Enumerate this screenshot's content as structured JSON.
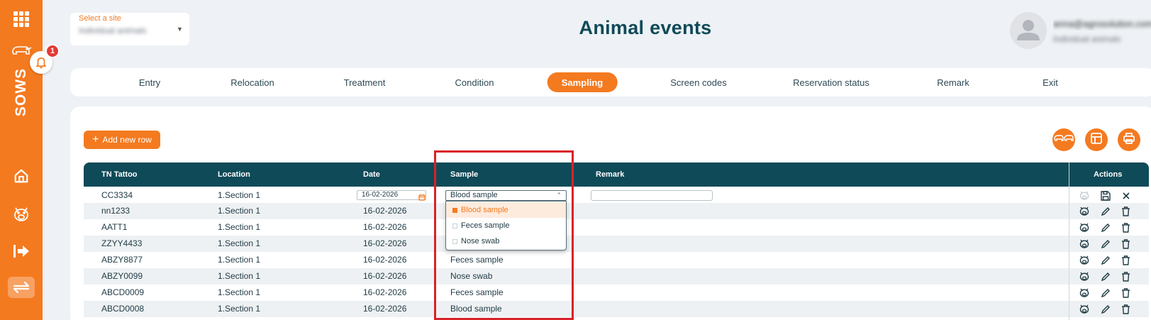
{
  "sidebar": {
    "app_label": "SOWS",
    "notification_count": "1",
    "icons": [
      "apps-grid-icon",
      "barn-icon",
      "bell-icon",
      "home-icon",
      "pig-icon",
      "exit-icon",
      "switch-icon"
    ]
  },
  "header": {
    "site_label": "Select a site",
    "site_value": "Individual animals",
    "title": "Animal events",
    "user_email": "anna@agrosolution.com",
    "user_site": "Individual animals"
  },
  "tabs": [
    {
      "label": "Entry",
      "active": false
    },
    {
      "label": "Relocation",
      "active": false
    },
    {
      "label": "Treatment",
      "active": false
    },
    {
      "label": "Condition",
      "active": false
    },
    {
      "label": "Sampling",
      "active": true
    },
    {
      "label": "Screen codes",
      "active": false
    },
    {
      "label": "Reservation status",
      "active": false
    },
    {
      "label": "Remark",
      "active": false
    },
    {
      "label": "Exit",
      "active": false
    }
  ],
  "toolbar": {
    "add_label": "Add new row",
    "icon_buttons": [
      "pigs-icon",
      "columns-icon",
      "print-icon"
    ]
  },
  "table": {
    "headers": {
      "tattoo": "TN Tattoo",
      "location": "Location",
      "date": "Date",
      "sample": "Sample",
      "remark": "Remark",
      "actions": "Actions"
    },
    "edit_row": {
      "tattoo": "CC3334",
      "location": "1.Section 1",
      "date": "16-02-2026",
      "sample": "Blood sample",
      "remark": ""
    },
    "rows": [
      {
        "tattoo": "nn1233",
        "location": "1.Section 1",
        "date": "16-02-2026",
        "sample": ""
      },
      {
        "tattoo": "AATT1",
        "location": "1.Section 1",
        "date": "16-02-2026",
        "sample": ""
      },
      {
        "tattoo": "ZZYY4433",
        "location": "1.Section 1",
        "date": "16-02-2026",
        "sample": ""
      },
      {
        "tattoo": "ABZY8877",
        "location": "1.Section 1",
        "date": "16-02-2026",
        "sample": "Feces sample"
      },
      {
        "tattoo": "ABZY0099",
        "location": "1.Section 1",
        "date": "16-02-2026",
        "sample": "Nose swab"
      },
      {
        "tattoo": "ABCD0009",
        "location": "1.Section 1",
        "date": "16-02-2026",
        "sample": "Feces sample"
      },
      {
        "tattoo": "ABCD0008",
        "location": "1.Section 1",
        "date": "16-02-2026",
        "sample": "Blood sample"
      }
    ]
  },
  "dropdown": {
    "options": [
      {
        "label": "Blood sample",
        "selected": true
      },
      {
        "label": "Feces sample",
        "selected": false
      },
      {
        "label": "Nose swab",
        "selected": false
      }
    ]
  },
  "colors": {
    "accent": "#f47a20",
    "header_bg": "#0f4a58",
    "highlight": "#d9212a",
    "badge": "#e53935"
  }
}
